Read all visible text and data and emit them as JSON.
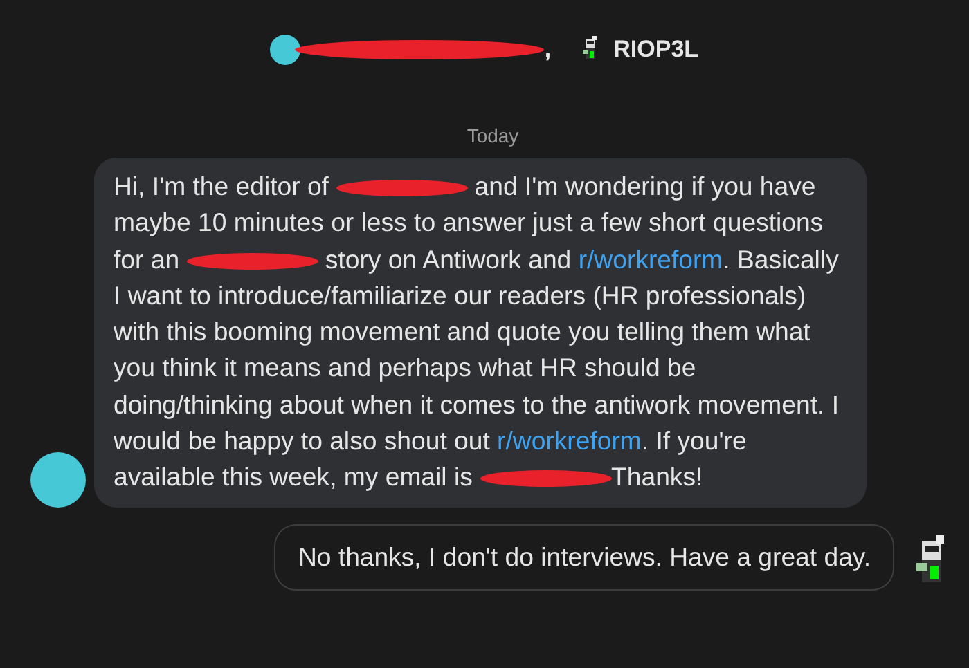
{
  "header": {
    "participants": [
      {
        "redacted": true
      },
      {
        "name": "RIOP3L",
        "redacted": false
      }
    ],
    "separator": ","
  },
  "date_divider": "Today",
  "messages": [
    {
      "kind": "incoming",
      "segments": [
        {
          "kind": "text",
          "text": "Hi, I'm the editor of "
        },
        {
          "kind": "redaction"
        },
        {
          "kind": "text",
          "text": " and I'm wondering if you have maybe 10 minutes or less to answer just a few short questions for an "
        },
        {
          "kind": "redaction"
        },
        {
          "kind": "text",
          "text": " story on Antiwork and "
        },
        {
          "kind": "link",
          "text": "r/workreform"
        },
        {
          "kind": "text",
          "text": ". Basically I want to introduce/familiarize our readers (HR professionals) with this booming movement and quote you telling them what you think it means and perhaps what HR should be doing/thinking about when it comes to the antiwork movement. I would be happy to also shout out "
        },
        {
          "kind": "link",
          "text": "r/workreform"
        },
        {
          "kind": "text",
          "text": ". If you're available this week, my email is "
        },
        {
          "kind": "redaction"
        },
        {
          "kind": "text",
          "text": "Thanks!"
        }
      ]
    },
    {
      "kind": "outgoing",
      "segments": [
        {
          "kind": "text",
          "text": "No thanks, I don't do interviews. Have a great day."
        }
      ]
    }
  ]
}
